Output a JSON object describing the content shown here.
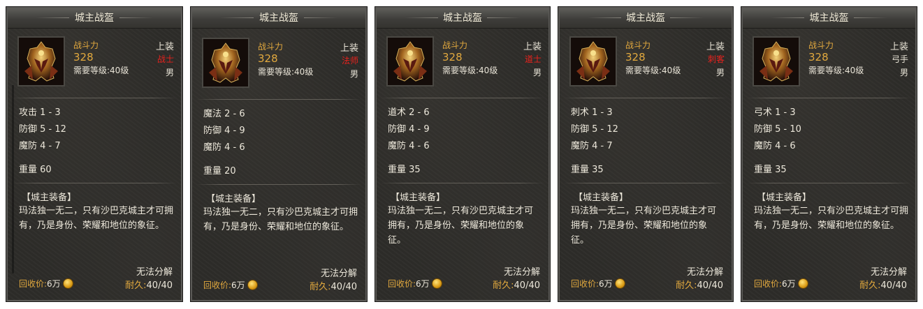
{
  "common": {
    "header_title": "城主战盔",
    "combat_label": "战斗力",
    "combat_value": "328",
    "level_req": "需要等级:40级",
    "slot": "上装",
    "gender": "男",
    "desc_title": "【城主装备】",
    "desc_text": "玛法独一无二，只有沙巴克城主才可拥有，乃是身份、荣耀和地位的象征。",
    "no_decompose": "无法分解",
    "recycle_label": "回收价:",
    "recycle_value": "6万",
    "durability_label": "耐久:",
    "durability_value": "40/40",
    "icon": "helmet-icon"
  },
  "colors": {
    "gold_text": "#e2a93e",
    "red_class": "#e8221d",
    "normal_text": "#e8e3d6"
  },
  "cards": [
    {
      "class_label": "战士",
      "class_color": "#e8221d",
      "attr1": "攻击 1 - 3",
      "attr2": "防御 5 - 12",
      "attr3": "魔防 4 - 7",
      "weight": "重量 60"
    },
    {
      "class_label": "法师",
      "class_color": "#e8221d",
      "attr1": "魔法 2 - 6",
      "attr2": "防御 4 - 9",
      "attr3": "魔防 4 - 6",
      "weight": "重量 20"
    },
    {
      "class_label": "道士",
      "class_color": "#e8221d",
      "attr1": "道术 2 - 6",
      "attr2": "防御 4 - 9",
      "attr3": "魔防 4 - 6",
      "weight": "重量 35"
    },
    {
      "class_label": "刺客",
      "class_color": "#e8221d",
      "attr1": "刺术 1 - 3",
      "attr2": "防御 5 - 12",
      "attr3": "魔防 4 - 7",
      "weight": "重量 35"
    },
    {
      "class_label": "弓手",
      "class_color": "#e8e3d6",
      "attr1": "弓术 1 - 3",
      "attr2": "防御 5 - 10",
      "attr3": "魔防 4 - 6",
      "weight": "重量 35"
    }
  ]
}
